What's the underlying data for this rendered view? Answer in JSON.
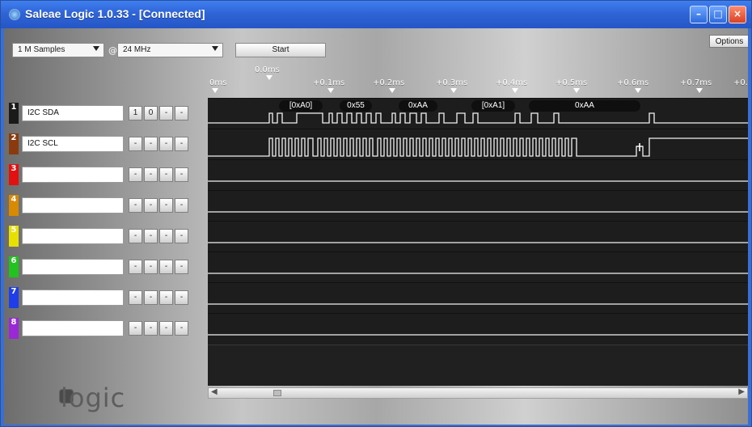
{
  "window": {
    "title": "Saleae Logic 1.0.33 - [Connected]",
    "buttons": [
      "minimize",
      "maximize",
      "close"
    ]
  },
  "toolbar": {
    "samples_value": "1 M Samples",
    "at_label": "@",
    "rate_value": "24 MHz",
    "start_label": "Start",
    "options_label": "Options"
  },
  "timeline": {
    "labels": [
      "0ms",
      "0.0ms",
      "+0.1ms",
      "+0.2ms",
      "+0.3ms",
      "+0.4ms",
      "+0.5ms",
      "+0.6ms",
      "+0.7ms",
      "+0."
    ]
  },
  "channels": [
    {
      "number": "1",
      "name": "I2C SDA",
      "color": "#1a1a1a",
      "controls": [
        "1",
        "0",
        "-",
        "-"
      ]
    },
    {
      "number": "2",
      "name": "I2C SCL",
      "color": "#8b3a0f",
      "controls": [
        "-",
        "-",
        "-",
        "-"
      ]
    },
    {
      "number": "3",
      "name": "",
      "color": "#e31010",
      "controls": [
        "-",
        "-",
        "-",
        "-"
      ]
    },
    {
      "number": "4",
      "name": "",
      "color": "#d88a00",
      "controls": [
        "-",
        "-",
        "-",
        "-"
      ]
    },
    {
      "number": "5",
      "name": "",
      "color": "#e8e000",
      "controls": [
        "-",
        "-",
        "-",
        "-"
      ]
    },
    {
      "number": "6",
      "name": "",
      "color": "#22c21f",
      "controls": [
        "-",
        "-",
        "-",
        "-"
      ]
    },
    {
      "number": "7",
      "name": "",
      "color": "#1f3eea",
      "controls": [
        "-",
        "-",
        "-",
        "-"
      ]
    },
    {
      "number": "8",
      "name": "",
      "color": "#9a28d6",
      "controls": [
        "-",
        "-",
        "-",
        "-"
      ]
    }
  ],
  "decode": {
    "labels": [
      "[0xA0]",
      "0x55",
      "0xAA",
      "[0xA1]",
      "0xAA"
    ]
  },
  "branding": {
    "logo_text": "logic"
  },
  "scrollbar": {
    "left_arrow": "◀",
    "right_arrow": "▶"
  }
}
